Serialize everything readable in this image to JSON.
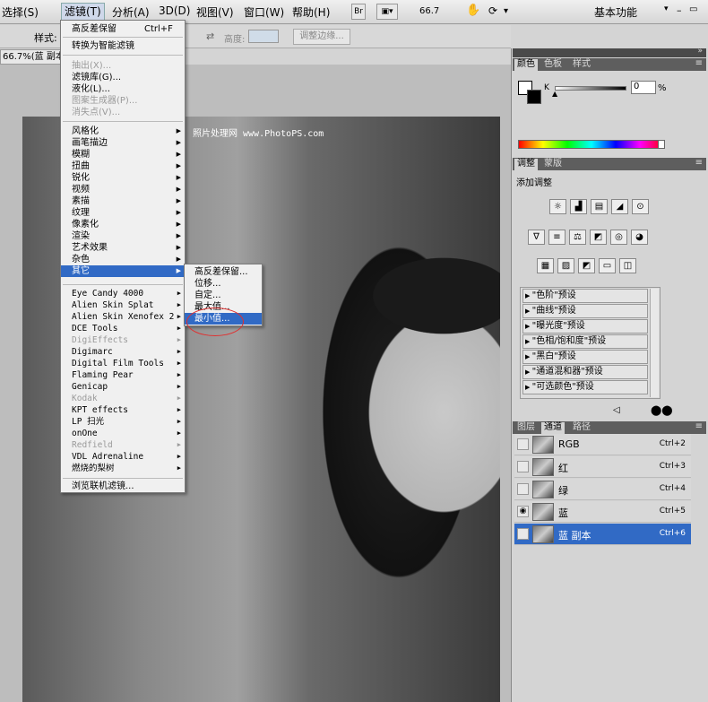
{
  "menubar": {
    "items": [
      "选择(S)",
      "滤镜(T)",
      "分析(A)",
      "3D(D)",
      "视图(V)",
      "窗口(W)",
      "帮助(H)"
    ],
    "br": "Br",
    "zoom": "66.7",
    "workspace": "基本功能"
  },
  "options": {
    "style_label": "样式:",
    "height_label": "高度:",
    "refine_button": "调整边缘..."
  },
  "doc_tab": "66.7%(蓝 副本/",
  "watermark": "照片处理网 www.PhotoPS.com",
  "filter_menu": {
    "last_filter": "高反差保留",
    "last_shortcut": "Ctrl+F",
    "smart": "转换为智能滤镜",
    "disabled_a": [
      "抽出(X)...",
      "图案生成器(P)...",
      "消失点(V)..."
    ],
    "enabled_a": [
      "滤镜库(G)...",
      "液化(L)..."
    ],
    "groups": [
      "风格化",
      "画笔描边",
      "模糊",
      "扭曲",
      "锐化",
      "视频",
      "素描",
      "纹理",
      "像素化",
      "渲染",
      "艺术效果",
      "杂色",
      "其它"
    ],
    "plugins": [
      "Eye Candy 4000",
      "Alien Skin Splat",
      "Alien Skin Xenofex 2",
      "DCE Tools",
      "DigiEffects",
      "Digimarc",
      "Digital Film Tools",
      "Flaming Pear",
      "Genicap",
      "Kodak",
      "KPT effects",
      "LP 扫光",
      "onOne",
      "Redfield",
      "VDL Adrenaline",
      "燃烧的梨树"
    ],
    "browse": "浏览联机滤镜..."
  },
  "other_submenu": [
    "高反差保留...",
    "位移...",
    "自定...",
    "最大值...",
    "最小值..."
  ],
  "color_panel": {
    "tabs": [
      "颜色",
      "色板",
      "样式"
    ],
    "k_label": "K",
    "k_value": "0",
    "unit": "%"
  },
  "adjust_panel": {
    "tabs": [
      "调整",
      "蒙版"
    ],
    "title": "添加调整",
    "presets": [
      "\"色阶\"预设",
      "\"曲线\"预设",
      "\"曝光度\"预设",
      "\"色相/饱和度\"预设",
      "\"黑白\"预设",
      "\"通道混和器\"预设",
      "\"可选颜色\"预设"
    ]
  },
  "channels_panel": {
    "tabs": [
      "图层",
      "通道",
      "路径"
    ],
    "rows": [
      {
        "name": "RGB",
        "key": "Ctrl+2"
      },
      {
        "name": "红",
        "key": "Ctrl+3"
      },
      {
        "name": "绿",
        "key": "Ctrl+4"
      },
      {
        "name": "蓝",
        "key": "Ctrl+5"
      },
      {
        "name": "蓝 副本",
        "key": "Ctrl+6"
      }
    ]
  },
  "colors": {
    "highlight": "#316ac5",
    "panel_header": "#5e5e5e"
  }
}
